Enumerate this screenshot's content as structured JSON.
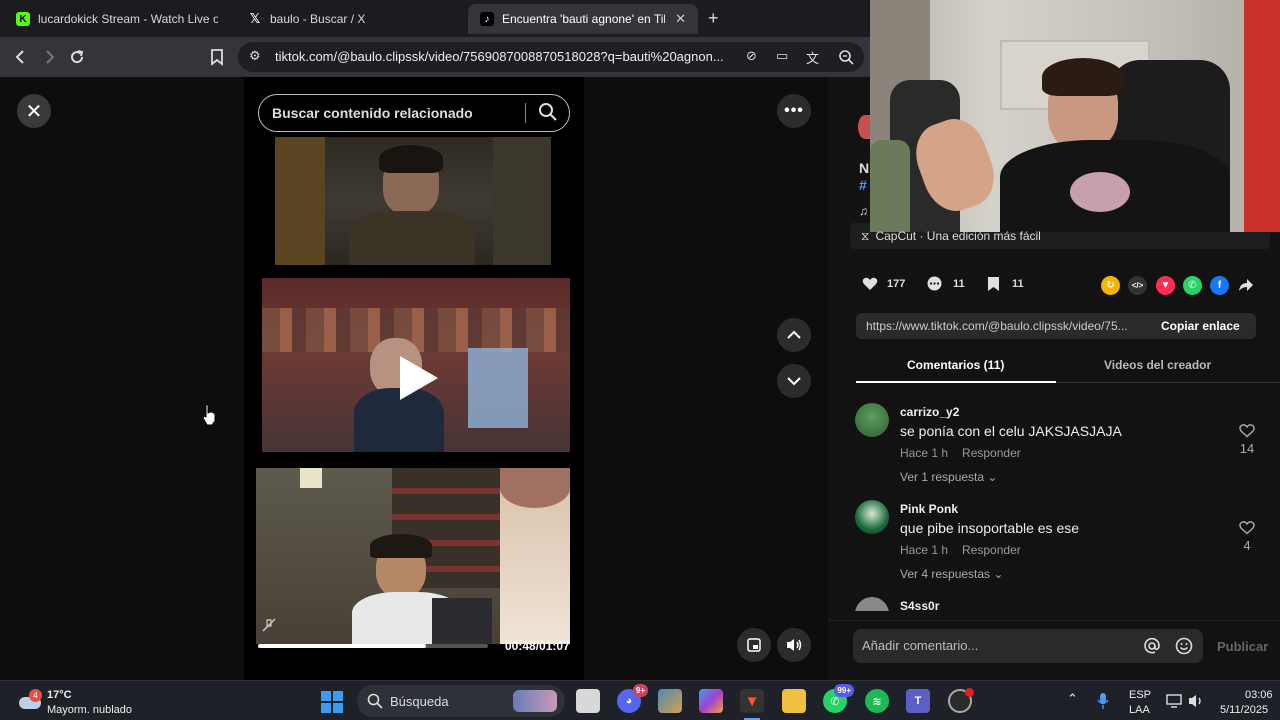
{
  "browser": {
    "tabs": [
      {
        "title": "lucardokick Stream - Watch Live on K",
        "icon": "kick-icon",
        "active": false
      },
      {
        "title": "baulo - Buscar / X",
        "icon": "x-icon",
        "active": false
      },
      {
        "title": "Encuentra 'bauti agnone' en TikT",
        "icon": "tiktok-icon",
        "active": true
      }
    ],
    "new_tab": "+",
    "tab_close": "✕",
    "url": "tiktok.com/@baulo.clipssk/video/7569087008870518028?q=bauti%20agnon..."
  },
  "viewer": {
    "close": "✕",
    "search_placeholder": "Buscar contenido relacionado",
    "more": "•••",
    "timecode": "00:48/01:07",
    "progress": 0.73
  },
  "panel": {
    "capcut": "CapCut · Una edición más fácil",
    "stats": {
      "likes": "177",
      "comments": "11",
      "saves": "11"
    },
    "link": "https://www.tiktok.com/@baulo.clipssk/video/75...",
    "copy_label": "Copiar enlace",
    "tabs": [
      "Comentarios (11)",
      "Videos del creador"
    ],
    "comments": [
      {
        "user": "carrizo_y2",
        "text": "se ponía con el celu JAKSJASJAJA",
        "time": "Hace 1 h",
        "reply": "Responder",
        "replies": "Ver 1 respuesta",
        "likes": "14"
      },
      {
        "user": "Pink Ponk",
        "text": "que pibe insoportable es ese",
        "time": "Hace 1 h",
        "reply": "Responder",
        "replies": "Ver 4 respuestas",
        "likes": "4"
      },
      {
        "user": "S4ss0r"
      }
    ],
    "add_comment": "Añadir comentario...",
    "publish": "Publicar",
    "partial_letters": [
      "N",
      "#",
      "♫"
    ]
  },
  "taskbar": {
    "weather_temp": "17°C",
    "weather_desc": "Mayorm. nublado",
    "weather_badge": "4",
    "search": "Búsqueda",
    "lang": "ESP",
    "lang2": "LAA",
    "time": "03:06",
    "date": "5/11/2025",
    "discord_badge": "9+",
    "whatsapp_badge": "99+"
  },
  "colors": {
    "accent_red": "#fe2c55",
    "kick_green": "#53fc18"
  }
}
